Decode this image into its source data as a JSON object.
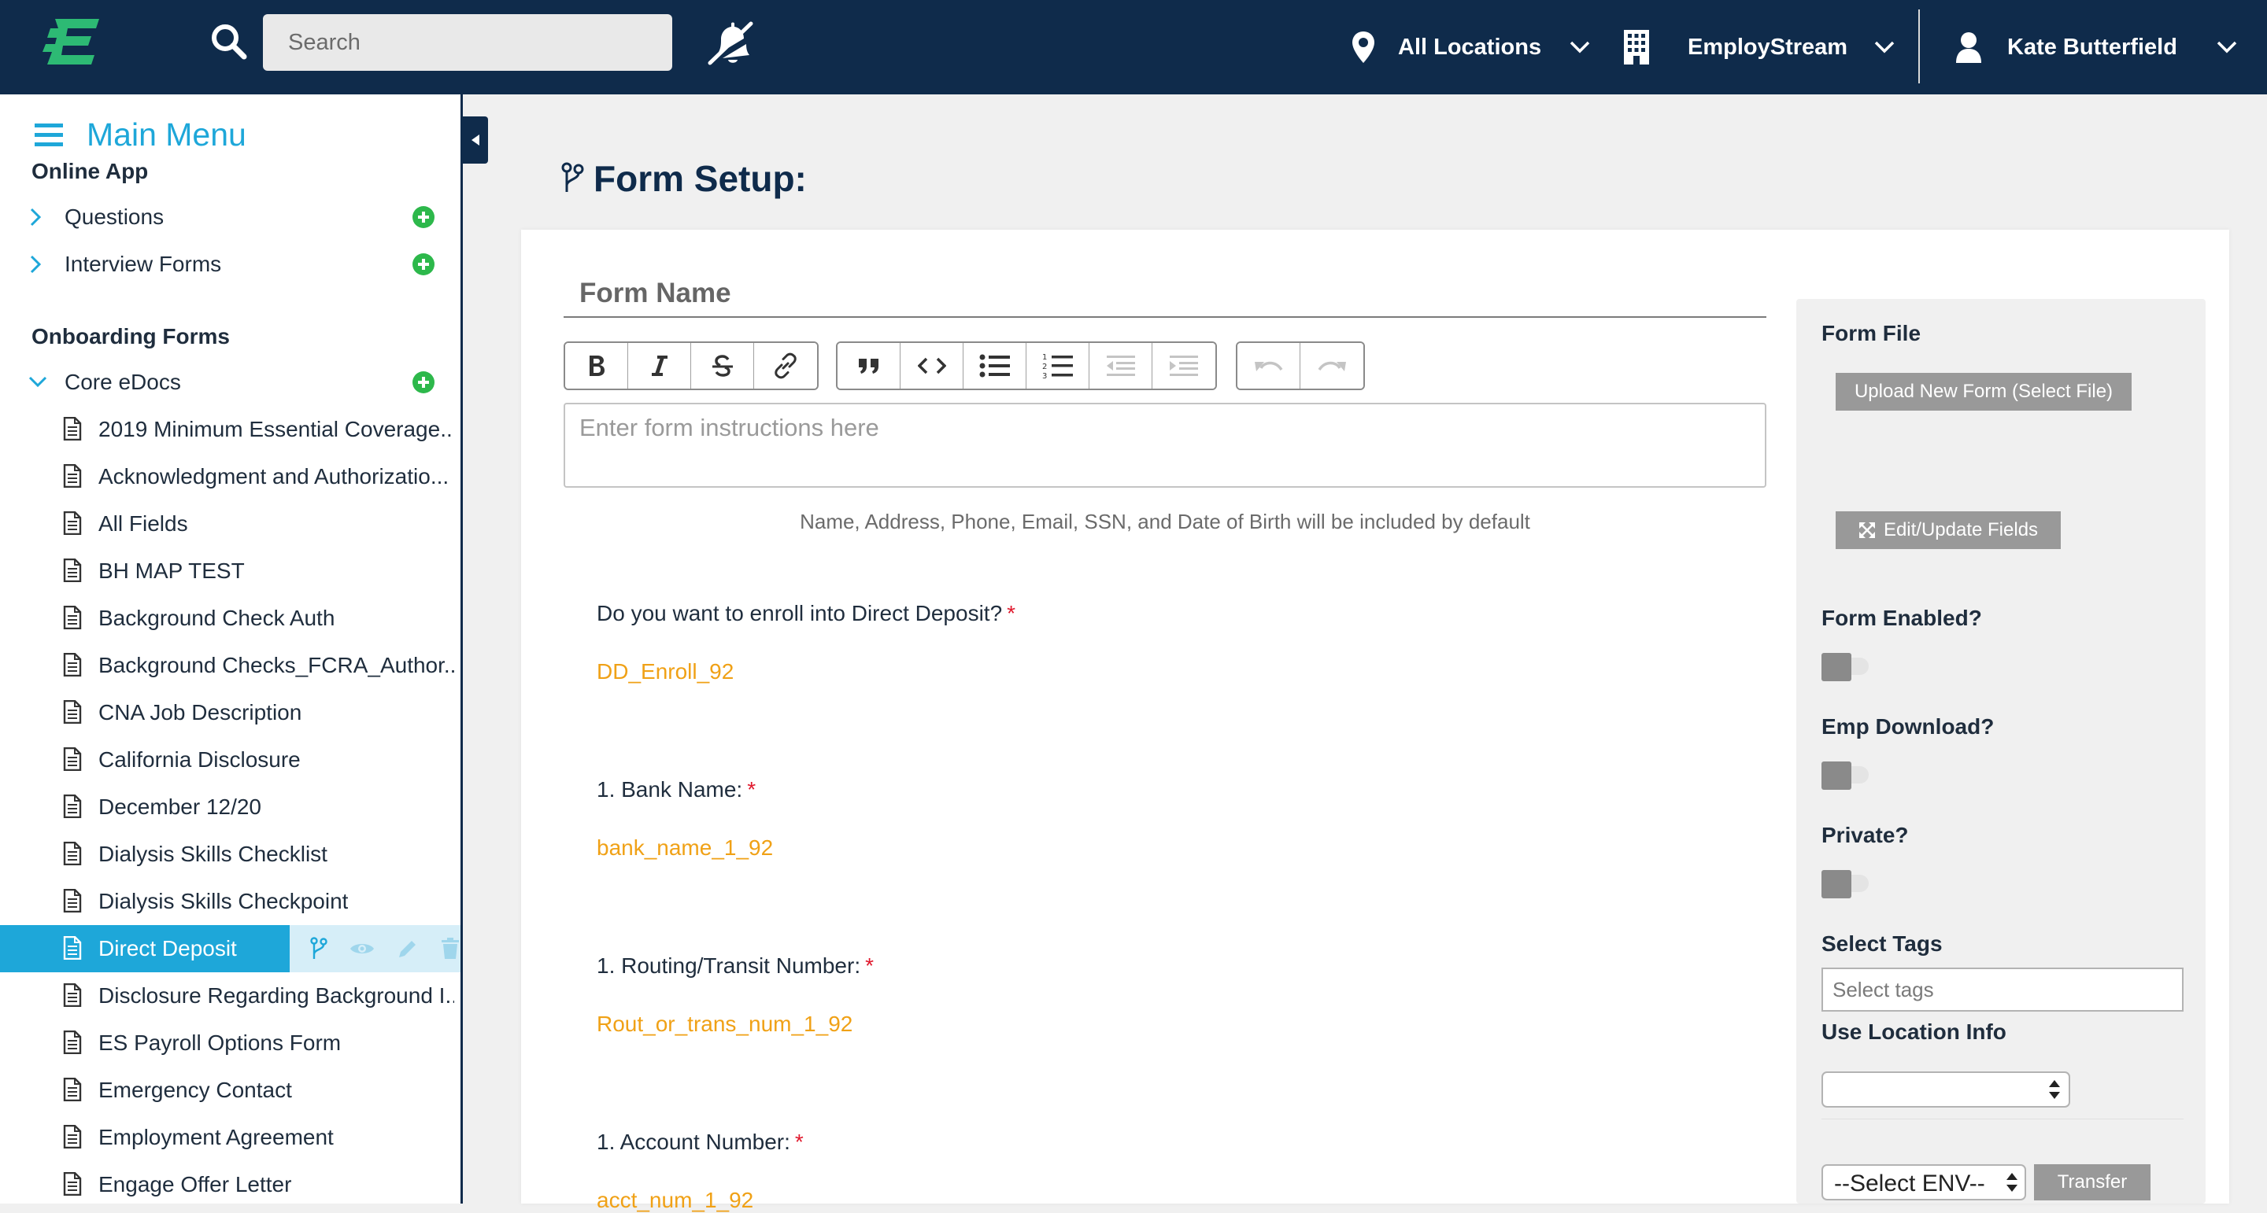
{
  "topbar": {
    "search_placeholder": "Search",
    "location_label": "All Locations",
    "company_label": "EmployStream",
    "user_label": "Kate Butterfield"
  },
  "sidebar": {
    "menu_title": "Main Menu",
    "online_app_title": "Online App",
    "online_app_items": [
      {
        "label": "Questions"
      },
      {
        "label": "Interview Forms"
      }
    ],
    "onboarding_title": "Onboarding Forms",
    "folder_label": "Core eDocs",
    "documents": [
      "2019 Minimum Essential Coverage...",
      "Acknowledgment and Authorizatio...",
      "All Fields",
      "BH MAP TEST",
      "Background Check Auth",
      "Background Checks_FCRA_Author...",
      "CNA Job Description",
      "California Disclosure",
      "December 12/20",
      "Dialysis Skills Checklist",
      "Dialysis Skills Checkpoint",
      "Direct Deposit",
      "Disclosure Regarding Background I...",
      "ES Payroll Options Form",
      "Emergency Contact",
      "Employment Agreement",
      "Engage Offer Letter"
    ],
    "active_document": "Direct Deposit"
  },
  "main": {
    "page_title": "Form Setup:",
    "form_name_placeholder": "Form Name",
    "instructions_placeholder": "Enter form instructions here",
    "default_note": "Name, Address, Phone, Email, SSN, and Date of Birth will be included by default",
    "questions": [
      {
        "label": "Do you want to enroll into Direct Deposit?",
        "required": "*",
        "field": "DD_Enroll_92"
      },
      {
        "label": "1. Bank Name:",
        "required": "*",
        "field": "bank_name_1_92"
      },
      {
        "label": "1. Routing/Transit Number:",
        "required": "*",
        "field": "Rout_or_trans_num_1_92"
      },
      {
        "label": "1. Account Number:",
        "required": "*",
        "field": "acct_num_1_92"
      }
    ]
  },
  "panel": {
    "form_file_label": "Form File",
    "upload_button": "Upload New Form (Select File)",
    "edit_fields_button": "Edit/Update Fields",
    "form_enabled_label": "Form Enabled?",
    "emp_download_label": "Emp Download?",
    "private_label": "Private?",
    "select_tags_label": "Select Tags",
    "tags_placeholder": "Select tags",
    "use_location_label": "Use Location Info",
    "env_select_value": "--Select ENV--",
    "transfer_button": "Transfer"
  },
  "colors": {
    "navy": "#0f2b4b",
    "accent_blue": "#1ea7d9",
    "logo_green": "#2dba74",
    "field_orange": "#f0a116",
    "required_red": "#e0192d",
    "add_green": "#2db84b"
  }
}
